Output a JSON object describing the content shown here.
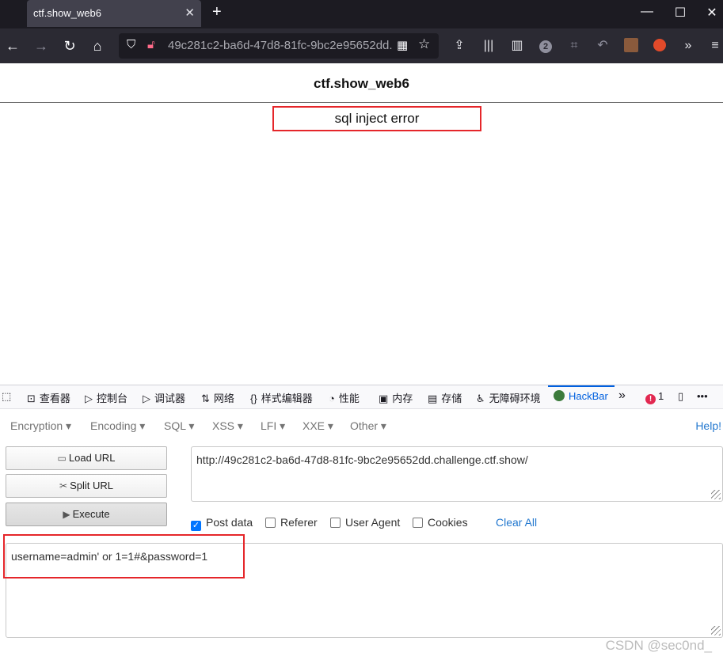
{
  "browser": {
    "tab_title": "ctf.show_web6",
    "tab_close": "✕",
    "new_tab": "+",
    "window_controls": [
      "—",
      "☐",
      "✕"
    ],
    "url_display": "49c281c2-ba6d-47d8-81fc-9bc2e95652dd.",
    "notification_badge": "2"
  },
  "page": {
    "title": "ctf.show_web6",
    "error_message": "sql inject error"
  },
  "devtools": {
    "tabs": [
      {
        "icon": "⊡",
        "label": "查看器"
      },
      {
        "icon": "▷",
        "label": "控制台"
      },
      {
        "icon": "▷",
        "label": "调试器"
      },
      {
        "icon": "⇅",
        "label": "网络"
      },
      {
        "icon": "{}",
        "label": "样式编辑器"
      },
      {
        "icon": "◔",
        "label": "性能"
      },
      {
        "icon": "▣",
        "label": "内存"
      },
      {
        "icon": "▤",
        "label": "存储"
      },
      {
        "icon": "♿",
        "label": "无障碍环境"
      }
    ],
    "hackbar_tab": "HackBar",
    "error_count": "1",
    "more": "»"
  },
  "hackbar": {
    "menu": [
      "Encryption ▾",
      "Encoding ▾",
      "SQL ▾",
      "XSS ▾",
      "LFI ▾",
      "XXE ▾",
      "Other ▾"
    ],
    "help": "Help!",
    "buttons": {
      "load": "Load URL",
      "split": "Split URL",
      "execute": "Execute"
    },
    "url_value": "http://49c281c2-ba6d-47d8-81fc-9bc2e95652dd.challenge.ctf.show/",
    "options": {
      "post_data": "Post data",
      "referer": "Referer",
      "user_agent": "User Agent",
      "cookies": "Cookies",
      "clear_all": "Clear All"
    },
    "post_body": "username=admin' or 1=1#&password=1"
  },
  "watermark": "CSDN @sec0nd_"
}
